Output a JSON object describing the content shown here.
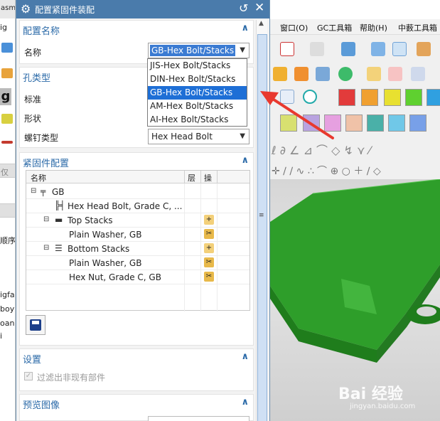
{
  "dialog": {
    "title": "配置紧固件装配",
    "sections": {
      "config_name": {
        "title": "配置名称",
        "name_label": "名称",
        "selected": "GB-Hex Bolt/Stacks"
      },
      "hole_type": {
        "title": "孔类型",
        "standard_label": "标准",
        "shape_label": "形状",
        "screw_type_label": "螺钉类型",
        "screw_type_value": "Hex Head Bolt"
      },
      "fastener_config": {
        "title": "紧固件配置",
        "columns": {
          "name": "名称",
          "layer": "层",
          "op": "操"
        },
        "rows": [
          {
            "label": "GB"
          },
          {
            "label": "Hex Head Bolt, Grade C, ..."
          },
          {
            "label": "Top Stacks"
          },
          {
            "label": "Plain Washer, GB"
          },
          {
            "label": "Bottom Stacks"
          },
          {
            "label": "Plain Washer, GB"
          },
          {
            "label": "Hex Nut, Grade C, GB"
          }
        ]
      },
      "settings": {
        "title": "设置",
        "filter_label": "过滤出非现有部件"
      },
      "preview": {
        "title": "预览图像"
      }
    },
    "dropdown_options": [
      "JIS-Hex Bolt/Stacks",
      "DIN-Hex Bolt/Stacks",
      "GB-Hex Bolt/Stacks",
      "AM-Hex Bolt/Stacks",
      "AI-Hex Bolt/Stacks"
    ]
  },
  "app": {
    "left_strip": {
      "top": "asm",
      "items": [
        "ig",
        "g",
        "仅",
        "顺序",
        "igfab",
        "boy",
        "oan",
        "i"
      ]
    },
    "menu": [
      "窗口(O)",
      "GC工具箱",
      "帮助(H)",
      "中薮工具箱"
    ]
  },
  "colors": {
    "titlebar": "#4a7bab",
    "section_title": "#2b6aa8",
    "selected_item": "#1e6fd6",
    "model_green": "#2e9e2a",
    "annotation_arrow": "#e8392f"
  },
  "watermark": {
    "brand": "Bai 经验",
    "url": "jingyan.baidu.com"
  }
}
